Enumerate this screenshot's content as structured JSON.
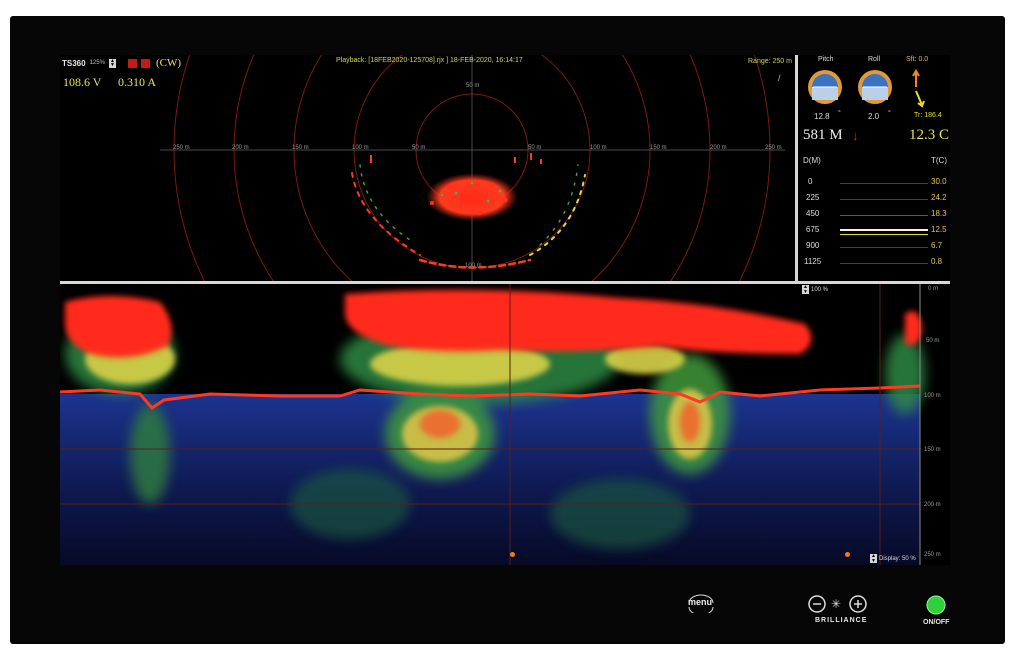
{
  "sonar": {
    "model": "TS360",
    "gain": "125%",
    "mode": "(CW)",
    "voltage": "108.6 V",
    "current": "0.310 A",
    "playback": "Playback: [18FEB2020-125708].rjx ] 18-FEB-2020, 16:14:17",
    "range": "Range: 250 m",
    "ring_labels": [
      "250 m",
      "200 m",
      "150 m",
      "100 m",
      "50 m",
      "50 m",
      "100 m",
      "150 m",
      "200 m",
      "250 m"
    ],
    "top_ring_label": "50 m",
    "bottom_ring_label": "100 m",
    "north_icon": "north-marker-icon"
  },
  "panel": {
    "pitch_label": "Pitch",
    "roll_label": "Roll",
    "shift_label": "Sft: 0.0",
    "pitch_value": "12.8",
    "pitch_unit": "°",
    "roll_value": "2.0",
    "roll_unit": "°",
    "tr_label": "Tr: 186.4",
    "depth_value": "581 M",
    "temp_value": "12.3 C",
    "depth_header": "D(M)",
    "temp_header": "T(C)",
    "profile": [
      {
        "depth": "0",
        "temp": "30.0"
      },
      {
        "depth": "225",
        "temp": "24.2"
      },
      {
        "depth": "450",
        "temp": "18.3"
      },
      {
        "depth": "675",
        "temp": "12.5"
      },
      {
        "depth": "900",
        "temp": "6.7"
      },
      {
        "depth": "1125",
        "temp": "0.8"
      }
    ]
  },
  "echo": {
    "top_percent": "100 %",
    "display_percent": "Display: 50 %",
    "depth_ticks": [
      "0 m",
      "50 m",
      "100 m",
      "150 m",
      "200 m",
      "250 m"
    ]
  },
  "controls": {
    "menu_label": "menu",
    "brilliance_label": "BRILLIANCE",
    "power_label": "ON/OFF"
  },
  "colors": {
    "echo_red": "#ff2a1a",
    "echo_yellow": "#e7e04a",
    "echo_green": "#3fae4e",
    "echo_blue": "#1a2c8c",
    "power_green": "#2dd13a"
  }
}
